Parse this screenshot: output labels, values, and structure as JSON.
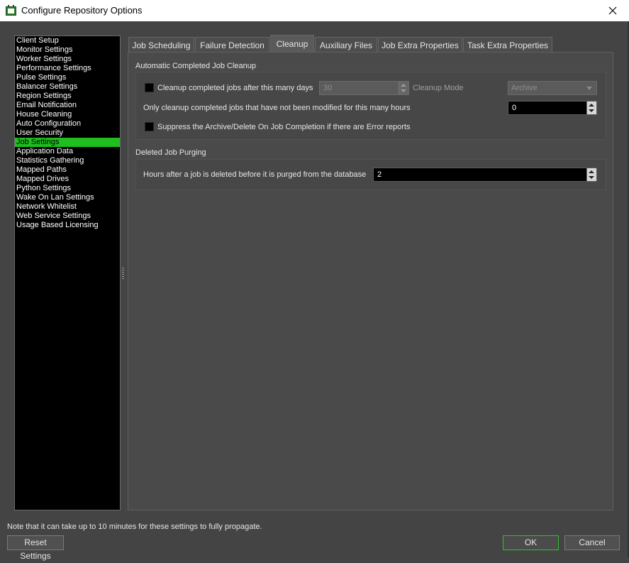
{
  "window": {
    "title": "Configure Repository Options"
  },
  "sidebar": {
    "selected_index": 11,
    "items": [
      {
        "label": "Client Setup"
      },
      {
        "label": "Monitor Settings"
      },
      {
        "label": "Worker Settings"
      },
      {
        "label": "Performance Settings"
      },
      {
        "label": "Pulse Settings"
      },
      {
        "label": "Balancer Settings"
      },
      {
        "label": "Region Settings"
      },
      {
        "label": "Email Notification"
      },
      {
        "label": "House Cleaning"
      },
      {
        "label": "Auto Configuration"
      },
      {
        "label": "User Security"
      },
      {
        "label": "Job Settings"
      },
      {
        "label": "Application Data"
      },
      {
        "label": "Statistics Gathering"
      },
      {
        "label": "Mapped Paths"
      },
      {
        "label": "Mapped Drives"
      },
      {
        "label": "Python Settings"
      },
      {
        "label": "Wake On Lan Settings"
      },
      {
        "label": "Network Whitelist"
      },
      {
        "label": "Web Service Settings"
      },
      {
        "label": "Usage Based Licensing"
      }
    ]
  },
  "tabs": [
    {
      "label": "Job Scheduling"
    },
    {
      "label": "Failure Detection"
    },
    {
      "label": "Cleanup"
    },
    {
      "label": "Auxiliary Files"
    },
    {
      "label": "Job Extra Properties"
    },
    {
      "label": "Task Extra Properties"
    }
  ],
  "active_tab_index": 2,
  "cleanup": {
    "auto_group_title": "Automatic Completed Job Cleanup",
    "cleanup_checkbox_label": "Cleanup completed jobs after this many days",
    "cleanup_checked": false,
    "cleanup_days": "30",
    "cleanup_mode_label": "Cleanup Mode",
    "cleanup_mode_value": "Archive",
    "not_modified_label": "Only cleanup completed jobs that have not been modified for this many hours",
    "not_modified_hours": "0",
    "suppress_label": "Suppress the Archive/Delete On Job Completion if there are Error reports",
    "suppress_checked": false,
    "purge_group_title": "Deleted Job Purging",
    "purge_label": "Hours after a job is deleted before it is purged from the database",
    "purge_hours": "2"
  },
  "footer": {
    "note": "Note that it can take up to 10 minutes for these settings to fully propagate.",
    "reset_label": "Reset Settings",
    "ok_label": "OK",
    "cancel_label": "Cancel"
  },
  "colors": {
    "accent": "#1fbf1f",
    "window_bg": "#444444",
    "list_bg": "#000000"
  }
}
